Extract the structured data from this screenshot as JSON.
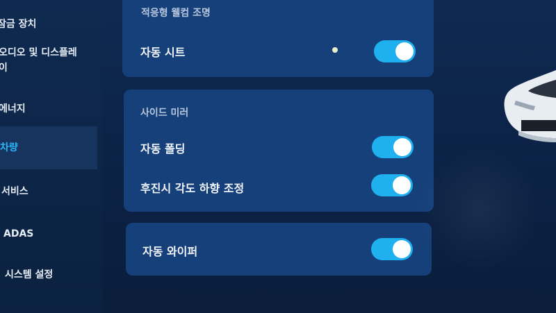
{
  "sidebar": {
    "items": [
      {
        "label": "잠금 장치"
      },
      {
        "label": "오디오 및 디스플레"
      },
      {
        "label": "이"
      },
      {
        "label": "에너지"
      },
      {
        "label": "차량"
      },
      {
        "label": "서비스"
      },
      {
        "label": "ADAS"
      },
      {
        "label": "시스템 설정"
      }
    ],
    "active_item": "차량"
  },
  "lighting": {
    "section_title": "적응형 웰컴 조명",
    "auto_seat_label": "자동 시트",
    "auto_seat_on": true
  },
  "side_mirror": {
    "section_title": "사이드 미러",
    "auto_folding_label": "자동 폴딩",
    "auto_folding_on": true,
    "reverse_tilt_label": "후진시 각도 하향 조정",
    "reverse_tilt_on": true
  },
  "wiper": {
    "auto_wiper_label": "자동 와이퍼",
    "auto_wiper_on": true
  },
  "colors": {
    "accent": "#1fb0ef",
    "panel": "#16407a",
    "background": "#0c2347"
  }
}
